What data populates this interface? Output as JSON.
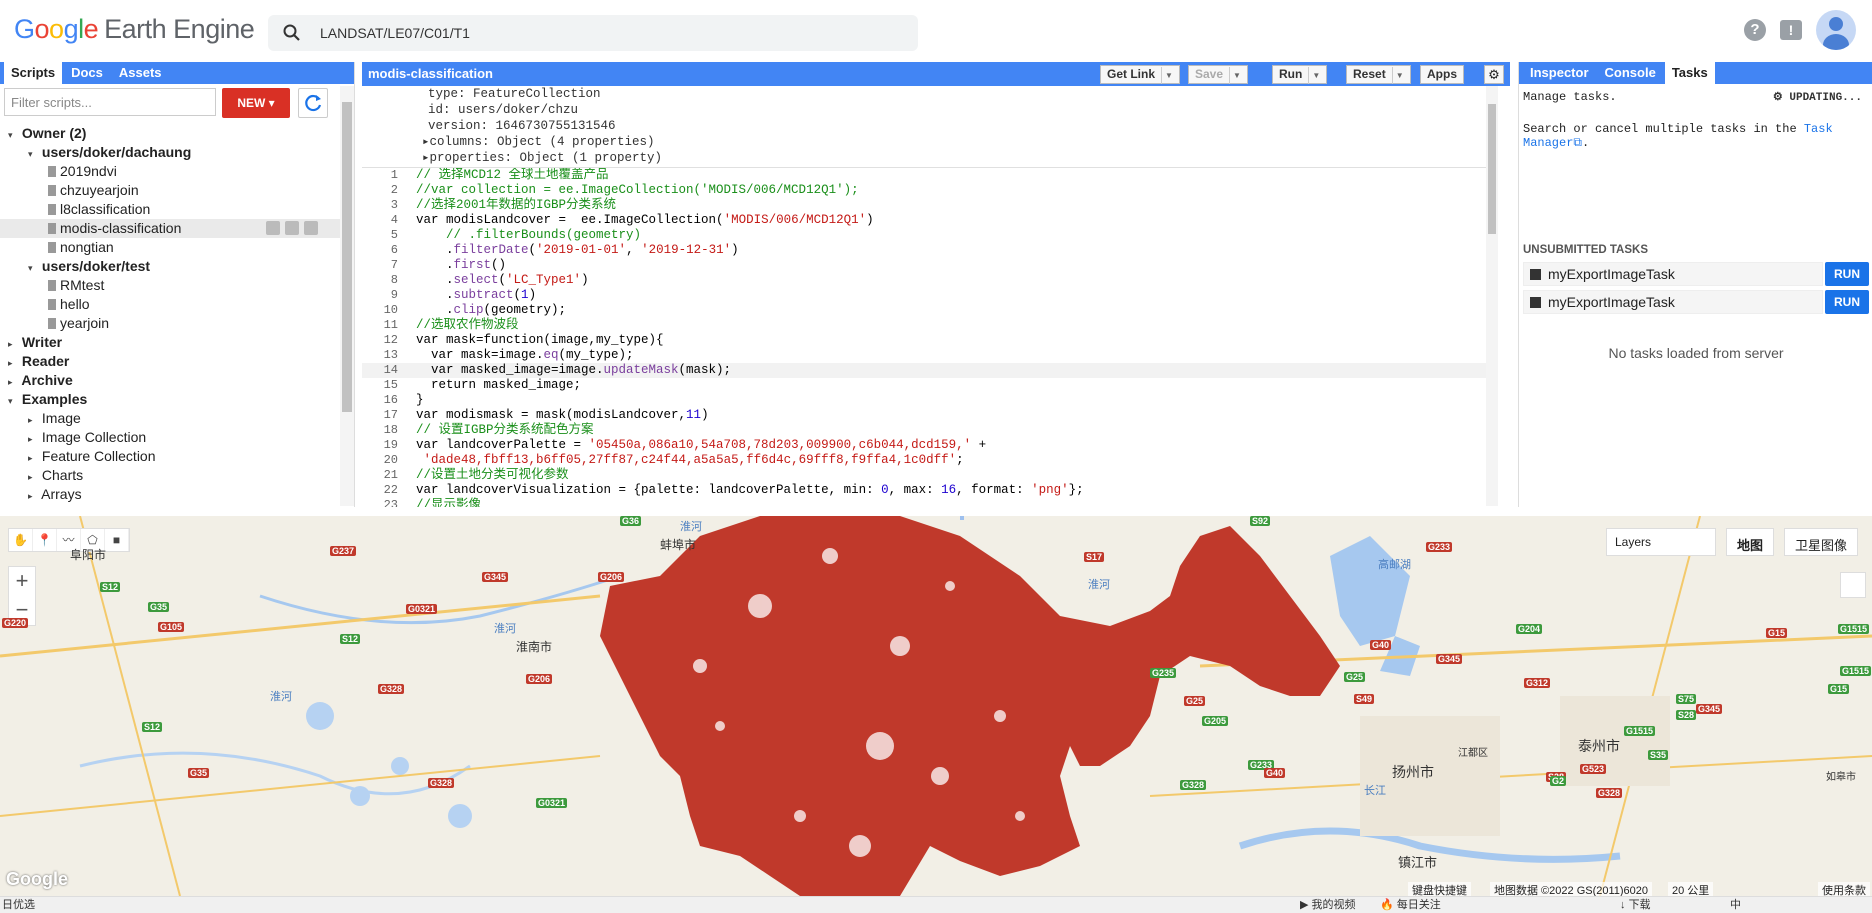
{
  "header": {
    "logo_google": "Google",
    "logo_product": "Earth Engine",
    "search_value": "LANDSAT/LE07/C01/T1"
  },
  "left_panel": {
    "tabs": [
      "Scripts",
      "Docs",
      "Assets"
    ],
    "filter_placeholder": "Filter scripts...",
    "new_label": "NEW",
    "tree": [
      {
        "label": "Owner (2)",
        "level": 0,
        "bold": true,
        "caret": "▾"
      },
      {
        "label": "users/doker/dachaung",
        "level": 1,
        "bold": true,
        "caret": "▾"
      },
      {
        "label": "2019ndvi",
        "level": 2,
        "file": true
      },
      {
        "label": "chzuyearjoin",
        "level": 2,
        "file": true
      },
      {
        "label": "l8classification",
        "level": 2,
        "file": true
      },
      {
        "label": "modis-classification",
        "level": 2,
        "file": true,
        "selected": true
      },
      {
        "label": "nongtian",
        "level": 2,
        "file": true
      },
      {
        "label": "users/doker/test",
        "level": 1,
        "bold": true,
        "caret": "▾"
      },
      {
        "label": "RMtest",
        "level": 2,
        "file": true
      },
      {
        "label": "hello",
        "level": 2,
        "file": true
      },
      {
        "label": "yearjoin",
        "level": 2,
        "file": true
      },
      {
        "label": "Writer",
        "level": 0,
        "bold": true,
        "caret": "▸"
      },
      {
        "label": "Reader",
        "level": 0,
        "bold": true,
        "caret": "▸"
      },
      {
        "label": "Archive",
        "level": 0,
        "bold": true,
        "caret": "▸"
      },
      {
        "label": "Examples",
        "level": 0,
        "bold": true,
        "caret": "▾"
      },
      {
        "label": "Image",
        "level": 1,
        "caret": "▸"
      },
      {
        "label": "Image Collection",
        "level": 1,
        "caret": "▸"
      },
      {
        "label": "Feature Collection",
        "level": 1,
        "caret": "▸"
      },
      {
        "label": "Charts",
        "level": 1,
        "caret": "▸"
      },
      {
        "label": "Arrays",
        "level": 1,
        "caret": "▸"
      }
    ]
  },
  "editor": {
    "title": "modis-classification",
    "buttons": {
      "get_link": "Get Link",
      "save": "Save",
      "run": "Run",
      "reset": "Reset",
      "apps": "Apps"
    },
    "output_lines": [
      "type: FeatureCollection",
      "id: users/doker/chzu",
      "version: 1646730755131546",
      "▸columns: Object (4 properties)",
      "▸properties: Object (1 property)"
    ],
    "code_lines": [
      {
        "n": "1",
        "html": "<span class='cm'>// 选择MCD12 全球土地覆盖产品</span>"
      },
      {
        "n": "2",
        "html": "<span class='cm'>//var collection = ee.ImageCollection('MODIS/006/MCD12Q1');</span>"
      },
      {
        "n": "3",
        "html": "<span class='cm'>//选择2001年数据的IGBP分类系统</span>"
      },
      {
        "n": "4",
        "html": "var modisLandcover =  ee.ImageCollection(<span class='st'>'MODIS/006/MCD12Q1'</span>)"
      },
      {
        "n": "5",
        "html": "    <span class='cm'>// .filterBounds(geometry)</span>"
      },
      {
        "n": "6",
        "html": "    .<span class='fn'>filterDate</span>(<span class='st'>'2019-01-01'</span>, <span class='st'>'2019-12-31'</span>)"
      },
      {
        "n": "7",
        "html": "    .<span class='fn'>first</span>()"
      },
      {
        "n": "8",
        "html": "    .<span class='fn'>select</span>(<span class='st'>'LC_Type1'</span>)"
      },
      {
        "n": "9",
        "html": "    .<span class='fn'>subtract</span>(<span class='nm'>1</span>)"
      },
      {
        "n": "10",
        "html": "    .<span class='fn'>clip</span>(geometry);"
      },
      {
        "n": "11",
        "html": "<span class='cm'>//选取农作物波段</span>"
      },
      {
        "n": "12",
        "html": "var mask=function(image,my_type){"
      },
      {
        "n": "13",
        "html": "  var mask=image.<span class='fn'>eq</span>(my_type);"
      },
      {
        "n": "14",
        "html": "  var masked_image=image.<span class='fn'>updateMask</span>(mask);",
        "current": true
      },
      {
        "n": "15",
        "html": "  return masked_image;"
      },
      {
        "n": "16",
        "html": "}"
      },
      {
        "n": "17",
        "html": "var modismask = mask(modisLandcover,<span class='nm'>11</span>)"
      },
      {
        "n": "18",
        "html": "<span class='cm'>// 设置IGBP分类系统配色方案</span>"
      },
      {
        "n": "19",
        "html": "var landcoverPalette = <span class='st'>'05450a,086a10,54a708,78d203,009900,c6b044,dcd159,'</span> +"
      },
      {
        "n": "20",
        "html": " <span class='st'>'dade48,fbff13,b6ff05,27ff87,c24f44,a5a5a5,ff6d4c,69fff8,f9ffa4,1c0dff'</span>;"
      },
      {
        "n": "21",
        "html": "<span class='cm'>//设置土地分类可视化参数</span>"
      },
      {
        "n": "22",
        "html": "var landcoverVisualization = {palette: landcoverPalette, min: <span class='nm'>0</span>, max: <span class='nm'>16</span>, format: <span class='st'>'png'</span>};"
      },
      {
        "n": "23",
        "html": "<span class='cm'>//显示影像</span>"
      }
    ]
  },
  "right_panel": {
    "tabs": [
      "Inspector",
      "Console",
      "Tasks"
    ],
    "manage_text": "Manage tasks.",
    "updating": "UPDATING...",
    "search_text": "Search or cancel multiple tasks in the ",
    "task_link1": "Task",
    "task_link2": "Manager",
    "unsubmitted_header": "UNSUBMITTED TASKS",
    "tasks": [
      {
        "name": "myExportImageTask",
        "action": "RUN"
      },
      {
        "name": "myExportImageTask",
        "action": "RUN"
      }
    ],
    "no_tasks": "No tasks loaded from server"
  },
  "map": {
    "layers_label": "Layers",
    "map_type_map": "地图",
    "map_type_satellite": "卫星图像",
    "zoom_in": "+",
    "zoom_out": "−",
    "cities": [
      "阜阳市",
      "蚌埠市",
      "淮南市",
      "扬州市",
      "泰州市",
      "镇江市",
      "江都区",
      "如皋市"
    ],
    "water_labels": [
      "淮河",
      "淮河",
      "淮河",
      "高邮湖",
      "长江",
      "淮河"
    ],
    "roads": [
      "G237",
      "G36",
      "S92",
      "G233",
      "G345",
      "G206",
      "S12",
      "G35",
      "G0321",
      "G105",
      "G220",
      "S12",
      "G206",
      "G328",
      "S12",
      "G35",
      "G328",
      "G0321",
      "S17",
      "G235",
      "G25",
      "G205",
      "G25",
      "S49",
      "G345",
      "G233",
      "G40",
      "G328",
      "G40",
      "G312",
      "S28",
      "G328",
      "G1515",
      "S35",
      "G2",
      "G523",
      "G345",
      "S28",
      "G15",
      "G204",
      "S75",
      "G1515",
      "G15",
      "G1515"
    ],
    "google_logo": "Google",
    "attr_shortcuts": "键盘快捷键",
    "attr_data": "地图数据 ©2022 GS(2011)6020",
    "attr_scale": "20 公里",
    "attr_terms": "使用条款"
  },
  "statusbar": {
    "left": "日优选",
    "items": [
      "我的视频",
      "每日关注",
      "下载",
      "中"
    ]
  }
}
